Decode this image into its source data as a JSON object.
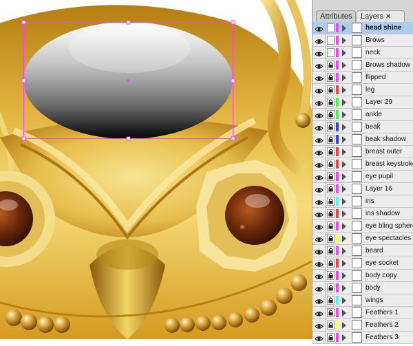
{
  "panel": {
    "tabs": [
      {
        "label": "Attributes"
      },
      {
        "label": "Layers",
        "close": "✕"
      }
    ],
    "layers": [
      {
        "name": "head shine",
        "color": "#ff3cff",
        "selected": true
      },
      {
        "name": "Brows",
        "color": "#ff3cff"
      },
      {
        "name": "neck",
        "color": "#ff3cff"
      },
      {
        "name": "Brows shadow",
        "color": "#ff3cff"
      },
      {
        "name": "flipped",
        "color": "#ff3cff"
      },
      {
        "name": "leg",
        "color": "#ff3c3c"
      },
      {
        "name": "Layer 29",
        "color": "#3cff3c"
      },
      {
        "name": "ankle",
        "color": "#3cff3c"
      },
      {
        "name": "beak",
        "color": "#3c3cff"
      },
      {
        "name": "beak shadow",
        "color": "#3c3cff"
      },
      {
        "name": "breast outer",
        "color": "#ff3c3c"
      },
      {
        "name": "breast keystroke",
        "color": "#ff3c3c"
      },
      {
        "name": "eye pupil",
        "color": "#ff3cff"
      },
      {
        "name": "Layer 16",
        "color": "#ff3cff"
      },
      {
        "name": "iris",
        "color": "#3cffff"
      },
      {
        "name": "iris shadow",
        "color": "#ff3c3c"
      },
      {
        "name": "eye bling spheres",
        "color": "#ff3cff"
      },
      {
        "name": "eye spectacles",
        "color": "#ffff3c"
      },
      {
        "name": "beard",
        "color": "#ff3cff"
      },
      {
        "name": "eye socket",
        "color": "#ff3c3c"
      },
      {
        "name": "body copy",
        "color": "#ff3cff"
      },
      {
        "name": "body",
        "color": "#ff3cff"
      },
      {
        "name": "wings",
        "color": "#3cffff"
      },
      {
        "name": "Feathers 1",
        "color": "#ff3cff"
      },
      {
        "name": "Feathers 2",
        "color": "#ffff3c"
      },
      {
        "name": "Feathers 3",
        "color": "#ff3cff"
      }
    ]
  }
}
